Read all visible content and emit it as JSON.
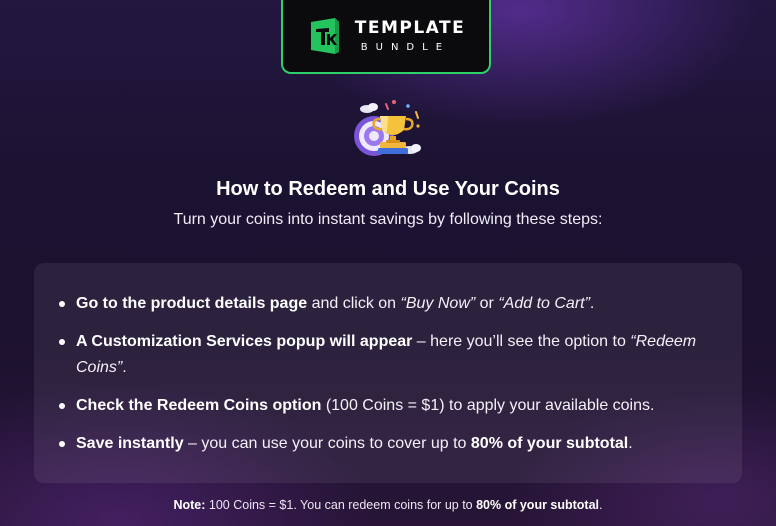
{
  "logo": {
    "line1": "TEMPLATE",
    "line2": "BUNDLE",
    "brand_color": "#2fd06a",
    "icon": "template-bundle-logo-icon"
  },
  "illustration": {
    "icon": "trophy-icon"
  },
  "heading": "How to Redeem and Use Your Coins",
  "subheading": "Turn your coins into instant savings by following these steps:",
  "steps": [
    {
      "bold": "Go to the product details page",
      "t1": " and click on ",
      "i1": "“Buy Now”",
      "t2": " or ",
      "i2": "“Add to Cart”",
      "t3": "."
    },
    {
      "bold": "A Customization Services popup will appear",
      "t1": " – here you’ll see the option to ",
      "i1": "“Redeem Coins”",
      "t2": "."
    },
    {
      "bold": "Check the Redeem Coins option",
      "t1": " (100 Coins = $1) to apply your available coins."
    },
    {
      "bold": "Save instantly",
      "t1": " – you can use your coins to cover up to ",
      "bold2": "80% of your subtotal",
      "t2": "."
    }
  ],
  "note": {
    "label": "Note:",
    "t1": " 100 Coins = $1. You can redeem coins for up to ",
    "bold": "80% of your subtotal",
    "t2": "."
  }
}
